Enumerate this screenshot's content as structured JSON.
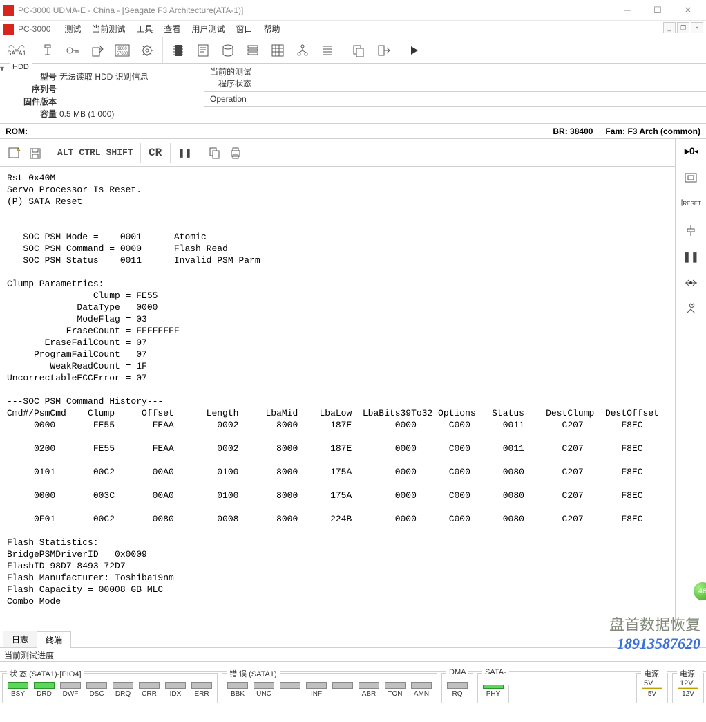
{
  "window": {
    "title": "PC-3000 UDMA-E - China - [Seagate F3 Architecture(ATA-1)]"
  },
  "menubar": {
    "app": "PC-3000",
    "items": [
      "测试",
      "当前测试",
      "工具",
      "查看",
      "用户测试",
      "窗口",
      "帮助"
    ]
  },
  "toolbar": {
    "sata_label": "SATA1"
  },
  "hdd": {
    "title": "HDD",
    "model_lbl": "型号",
    "model_val": "无法读取 HDD 识别信息",
    "serial_lbl": "序列号",
    "fw_lbl": "固件版本",
    "capacity_lbl": "容量",
    "capacity_val": "0.5 MB (1 000)"
  },
  "test": {
    "current_lbl": "当前的测试",
    "program_state": "程序状态",
    "operation": "Operation"
  },
  "rom": {
    "label": "ROM:",
    "br_lbl": "BR:",
    "br_val": "38400",
    "fam_lbl": "Fam:",
    "fam_val": "F3 Arch (common)"
  },
  "term_tb": {
    "alt": "ALT",
    "ctrl": "CTRL",
    "shift": "SHIFT",
    "cr": "CR",
    "pause": "❚❚"
  },
  "terminal_text": "Rst 0x40M\nServo Processor Is Reset.\n(P) SATA Reset\n\n\n   SOC PSM Mode =    0001      Atomic\n   SOC PSM Command = 0000      Flash Read\n   SOC PSM Status =  0011      Invalid PSM Parm\n\nClump Parametrics:\n                Clump = FE55\n             DataType = 0000\n             ModeFlag = 03\n           EraseCount = FFFFFFFF\n       EraseFailCount = 07\n     ProgramFailCount = 07\n        WeakReadCount = 1F\nUncorrectableECCError = 07\n\n---SOC PSM Command History---\nCmd#/PsmCmd    Clump     Offset      Length     LbaMid    LbaLow  LbaBits39To32 Options   Status    DestClump  DestOffset\n     0000       FE55       FEAA        0002       8000      187E        0000      C000      0011       C207       F8EC\n\n     0200       FE55       FEAA        0002       8000      187E        0000      C000      0011       C207       F8EC\n\n     0101       00C2       00A0        0100       8000      175A        0000      C000      0080       C207       F8EC\n\n     0000       003C       00A0        0100       8000      175A        0000      C000      0080       C207       F8EC\n\n     0F01       00C2       0080        0008       8000      224B        0000      C000      0080       C207       F8EC\n\nFlash Statistics:\nBridgePSMDriverID = 0x0009\nFlashID 98D7 8493 72D7\nFlash Manufacturer: Toshiba19nm\nFlash Capacity = 00008 GB MLC\nCombo Mode",
  "side": {
    "reset": "RESET"
  },
  "tabs": {
    "log": "日志",
    "terminal": "终端"
  },
  "progress": {
    "label": "当前测试进度"
  },
  "status": {
    "g1_label": "状 态 (SATA1)-[PIO4]",
    "g1_leds": [
      {
        "lbl": "BSY",
        "on": true,
        "color": "green"
      },
      {
        "lbl": "DRD",
        "on": true,
        "color": "green"
      },
      {
        "lbl": "DWF",
        "on": false
      },
      {
        "lbl": "DSC",
        "on": false
      },
      {
        "lbl": "DRQ",
        "on": false
      },
      {
        "lbl": "CRR",
        "on": false
      },
      {
        "lbl": "IDX",
        "on": false
      },
      {
        "lbl": "ERR",
        "on": false
      }
    ],
    "g2_label": "错 误 (SATA1)",
    "g2_leds": [
      {
        "lbl": "BBK",
        "on": false
      },
      {
        "lbl": "UNC",
        "on": false
      },
      {
        "lbl": "",
        "on": false
      },
      {
        "lbl": "INF",
        "on": false
      },
      {
        "lbl": "",
        "on": false
      },
      {
        "lbl": "ABR",
        "on": false
      },
      {
        "lbl": "TON",
        "on": false
      },
      {
        "lbl": "AMN",
        "on": false
      }
    ],
    "g3_label": "DMA",
    "g3_leds": [
      {
        "lbl": "RQ",
        "on": false
      }
    ],
    "g4_label": "SATA-II",
    "g4_leds": [
      {
        "lbl": "PHY",
        "on": true,
        "color": "green"
      }
    ],
    "g5_label": "电源 5V",
    "g5_leds": [
      {
        "lbl": "5V",
        "on": true,
        "color": "yellow"
      }
    ],
    "g6_label": "电源 12V",
    "g6_leds": [
      {
        "lbl": "12V",
        "on": true,
        "color": "yellow"
      }
    ]
  },
  "watermark": {
    "text": "盘首数据恢复",
    "phone": "18913587620"
  },
  "badge": "48"
}
